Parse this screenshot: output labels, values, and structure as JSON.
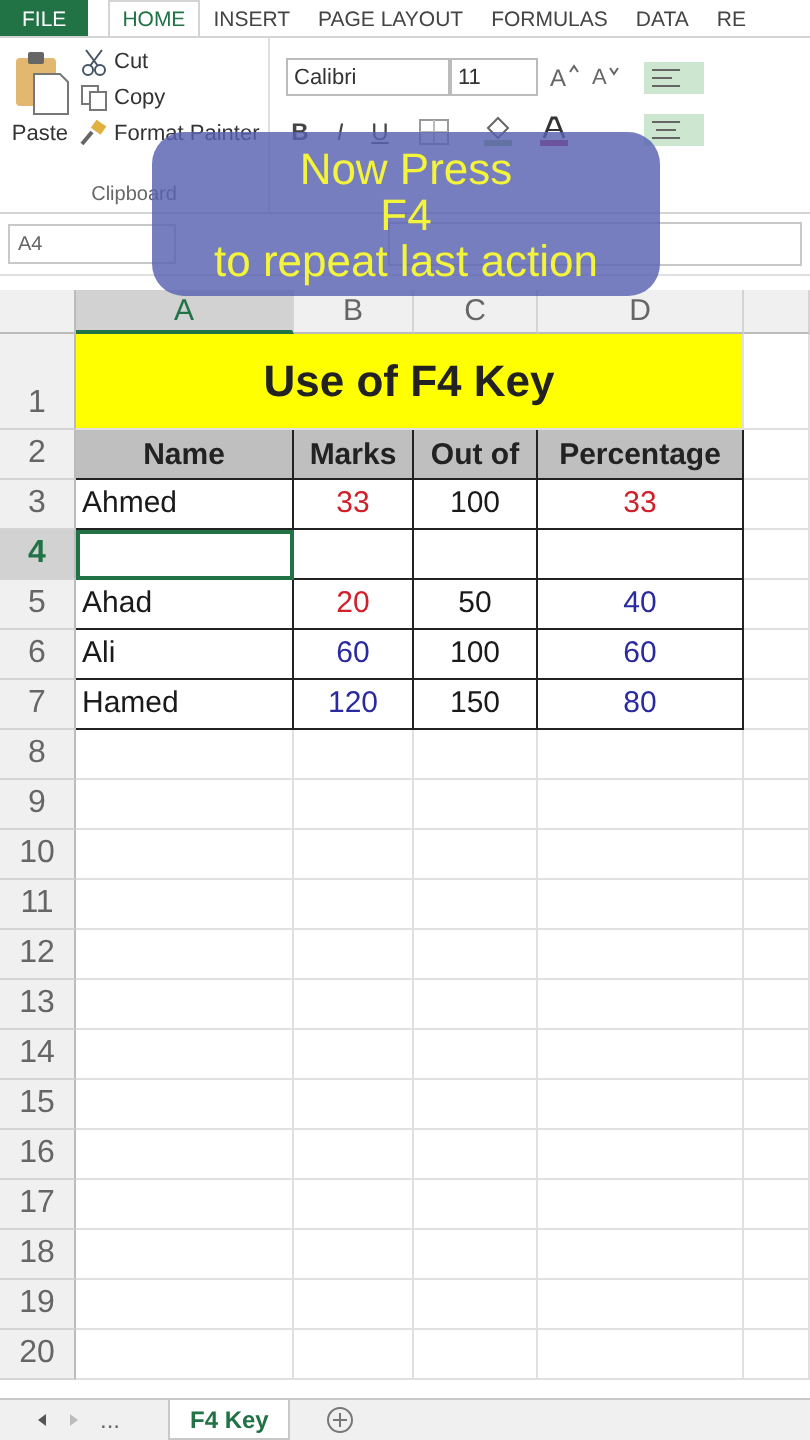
{
  "ribbon_tabs": [
    {
      "label": "FILE",
      "kind": "file",
      "selected": false
    },
    {
      "label": "HOME",
      "kind": "tab",
      "selected": true
    },
    {
      "label": "INSERT",
      "kind": "tab",
      "selected": false
    },
    {
      "label": "PAGE LAYOUT",
      "kind": "tab",
      "selected": false
    },
    {
      "label": "FORMULAS",
      "kind": "tab",
      "selected": false
    },
    {
      "label": "DATA",
      "kind": "tab",
      "selected": false
    },
    {
      "label": "RE",
      "kind": "tab",
      "selected": false
    }
  ],
  "clipboard": {
    "paste": "Paste",
    "cut": "Cut",
    "copy": "Copy",
    "format_painter": "Format Painter",
    "group_label": "Clipboard"
  },
  "font": {
    "name": "Calibri",
    "size": "11",
    "grow": "A",
    "shrink": "A",
    "bold": "B",
    "italic": "I",
    "underline": "U"
  },
  "name_box": "A4",
  "columns": [
    {
      "label": "A",
      "selected": true
    },
    {
      "label": "B",
      "selected": false
    },
    {
      "label": "C",
      "selected": false
    },
    {
      "label": "D",
      "selected": false
    }
  ],
  "rows": [
    {
      "number": "1",
      "kind": "title",
      "selected": false,
      "cells": [
        {
          "text": "Use of F4 Key"
        }
      ]
    },
    {
      "number": "2",
      "kind": "header",
      "selected": false,
      "cells": [
        {
          "text": "Name"
        },
        {
          "text": "Marks"
        },
        {
          "text": "Out of"
        },
        {
          "text": "Percentage"
        }
      ]
    },
    {
      "number": "3",
      "kind": "data",
      "selected": false,
      "cells": [
        {
          "text": "Ahmed",
          "color": "#1a1a1a"
        },
        {
          "text": "33",
          "color": "#d0202a"
        },
        {
          "text": "100",
          "color": "#1a1a1a"
        },
        {
          "text": "33",
          "color": "#d0202a"
        }
      ]
    },
    {
      "number": "4",
      "kind": "data",
      "selected": true,
      "cells": []
    },
    {
      "number": "5",
      "kind": "data",
      "selected": false,
      "cells": [
        {
          "text": "Ahad",
          "color": "#1a1a1a"
        },
        {
          "text": "20",
          "color": "#d0202a"
        },
        {
          "text": "50",
          "color": "#1a1a1a"
        },
        {
          "text": "40",
          "color": "#2a2aa0"
        }
      ]
    },
    {
      "number": "6",
      "kind": "data",
      "selected": false,
      "cells": [
        {
          "text": "Ali",
          "color": "#1a1a1a"
        },
        {
          "text": "60",
          "color": "#2a2aa0"
        },
        {
          "text": "100",
          "color": "#1a1a1a"
        },
        {
          "text": "60",
          "color": "#2a2aa0"
        }
      ]
    },
    {
      "number": "7",
      "kind": "data",
      "selected": false,
      "cells": [
        {
          "text": "Hamed",
          "color": "#1a1a1a"
        },
        {
          "text": "120",
          "color": "#2a2aa0"
        },
        {
          "text": "150",
          "color": "#1a1a1a"
        },
        {
          "text": "80",
          "color": "#2a2aa0"
        }
      ]
    },
    {
      "number": "8",
      "kind": "empty",
      "selected": false,
      "cells": []
    },
    {
      "number": "9",
      "kind": "empty",
      "selected": false,
      "cells": []
    },
    {
      "number": "10",
      "kind": "empty",
      "selected": false,
      "cells": []
    },
    {
      "number": "11",
      "kind": "empty",
      "selected": false,
      "cells": []
    },
    {
      "number": "12",
      "kind": "empty",
      "selected": false,
      "cells": []
    },
    {
      "number": "13",
      "kind": "empty",
      "selected": false,
      "cells": []
    },
    {
      "number": "14",
      "kind": "empty",
      "selected": false,
      "cells": []
    },
    {
      "number": "15",
      "kind": "empty",
      "selected": false,
      "cells": []
    },
    {
      "number": "16",
      "kind": "empty",
      "selected": false,
      "cells": []
    },
    {
      "number": "17",
      "kind": "empty",
      "selected": false,
      "cells": []
    },
    {
      "number": "18",
      "kind": "empty",
      "selected": false,
      "cells": []
    },
    {
      "number": "19",
      "kind": "empty",
      "selected": false,
      "cells": []
    },
    {
      "number": "20",
      "kind": "empty",
      "selected": false,
      "cells": []
    }
  ],
  "overlay": {
    "lines": [
      "Now Press",
      "F4",
      "to repeat last action"
    ]
  },
  "sheet_tabs": {
    "more": "...",
    "tabs": [
      {
        "label": "F4 Key",
        "selected": true
      }
    ]
  }
}
